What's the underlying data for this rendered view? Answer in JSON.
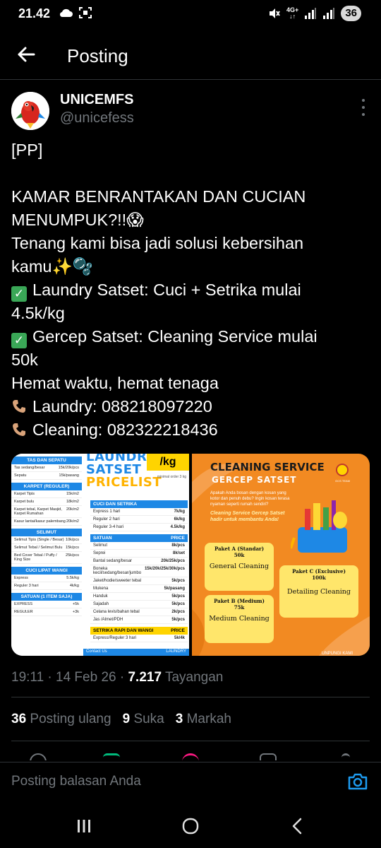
{
  "status_bar": {
    "time": "21.42",
    "network_type": "4G+",
    "battery": "36"
  },
  "header": {
    "title": "Posting"
  },
  "post": {
    "display_name": "UNICEMFS",
    "handle": "@unicefess",
    "text_lines": {
      "l1": "[PP]",
      "l3": "KAMAR BENRANTAKAN DAN CUCIAN",
      "l4": "MENUMPUK?!!😱",
      "l5": "Tenang kami bisa jadi solusi kebersihan",
      "l6": "kamu✨🫧",
      "l7": "Laundry Satset: Cuci + Setrika mulai",
      "l8": "4.5k/kg",
      "l9": "Gercep Satset: Cleaning Service mulai",
      "l10": "50k",
      "l11": "Hemat waktu, hemat tenaga",
      "l12": "Laundry: 088218097220",
      "l13": "Cleaning: 082322218436"
    },
    "timestamp": "19:11 · 14 Feb 26 · ",
    "views_count": "7.217",
    "views_label": " Tayangan",
    "stats": {
      "reposts_count": "36",
      "reposts_label": "Posting ulang",
      "likes_count": "9",
      "likes_label": "Suka",
      "bookmarks_count": "3",
      "bookmarks_label": "Markah"
    }
  },
  "media_left": {
    "title_line1": "LAUNDRY",
    "title_line2": "SATSET",
    "title_line3": "PRICELIST",
    "badge": "/kg",
    "note": "minimal order 3 kg",
    "col_a": {
      "sec1": "TAS DAN SEPATU",
      "r1": [
        "Tas sedang/besar",
        "15k/20k/pcs"
      ],
      "r2": [
        "Sepatu",
        "15k/pasang"
      ],
      "sec2": "KARPET (REGULER)",
      "r3": [
        "Karpet Tipis",
        "15k/m2"
      ],
      "r4": [
        "Karpet bulu",
        "18k/m2"
      ],
      "r5": [
        "Karpet tebal, Karpet Masjid, Karpet Rumahan",
        "20k/m2"
      ],
      "r6": [
        "Kasur lantai/kasur palembang",
        "20k/m2"
      ],
      "sec3": "SELIMUT",
      "r7": [
        "Selimut Tipis (Single / Besar)",
        "10k/pcs"
      ],
      "r8": [
        "Selimut Tebal / Selimut Bulu",
        "15k/pcs"
      ],
      "r9": [
        "Bed Cover Tebal / Puffy / King Size",
        "25k/pcs"
      ],
      "sec4": "CUCI LIPAT WANGI",
      "r10": [
        "Express",
        "5.5k/kg"
      ],
      "r11": [
        "Reguler 3 hari",
        "4k/kg"
      ],
      "sec5": "SATUAN (1 ITEM SAJA)",
      "r12": [
        "EXPRESS",
        "+5k"
      ],
      "r13": [
        "REGULER",
        "+3k"
      ]
    },
    "col_b": {
      "sec1": "CUCI DAN SETRIKA",
      "r1": [
        "Express 1 hari",
        "7k/kg"
      ],
      "r2": [
        "Reguler 2 hari",
        "6k/kg"
      ],
      "r3": [
        "Reguler 3-4 hari",
        "4.5k/kg"
      ],
      "sec2": "SATUAN",
      "sec2_right": "PRICE",
      "r4": [
        "Selimut",
        "8k/pcs"
      ],
      "r5": [
        "Seprei",
        "8k/set"
      ],
      "r6": [
        "Bantal sedang/besar",
        "20k/25k/pcs"
      ],
      "r7": [
        "Boneka kecil/sedang/besar/jumbo",
        "15k/20k/25k/30k/pcs"
      ],
      "r8": [
        "Jaket/hodie/sweeter tebal",
        "5k/pcs"
      ],
      "r9": [
        "Mukena",
        "5k/pasang"
      ],
      "r10": [
        "Handuk",
        "5k/pcs"
      ],
      "r11": [
        "Sajadah",
        "5k/pcs"
      ],
      "r12": [
        "Celana levis/bahan tebal",
        "2k/pcs"
      ],
      "r13": [
        "Jas /Almet/PDH",
        "5k/pcs"
      ],
      "sec3": "SETRIKA RAPI DAN WANGI",
      "sec3_right": "PRICE",
      "r14": [
        "Express/Reguler 3 hari",
        "5k/4k"
      ],
      "footer_left": "Contact Us",
      "footer_right": "LAUNDRY"
    }
  },
  "media_right": {
    "title": "CLEANING SERVICE",
    "subtitle": "GERCEP SATSET",
    "desc": "Apakah Anda bosan dengan kosan yang kotor dan penuh debu? Ingin kosan terasa nyaman seperti rumah sendiri?",
    "desc2": "Cleaning Service Gercep Satset hadir untuk membantu Anda!",
    "logo_text": "GCS TEAM",
    "pkg_a_name": "Paket A (Standar)",
    "pkg_a_price": "50k",
    "pkg_a_label": "General Cleaning",
    "pkg_b_name": "Paket B (Medium)",
    "pkg_b_price": "75k",
    "pkg_b_label": "Medium Cleaning",
    "pkg_c_name": "Paket C (Exclusive)",
    "pkg_c_price": "100k",
    "pkg_c_label": "Detailing Cleaning",
    "footer": "UNPUNGI KAMI"
  },
  "reply": {
    "placeholder": "Posting balasan Anda"
  },
  "colors": {
    "accent": "#1d9bf0",
    "bg": "#000000",
    "muted": "#71767b",
    "divider": "#2f3336"
  }
}
